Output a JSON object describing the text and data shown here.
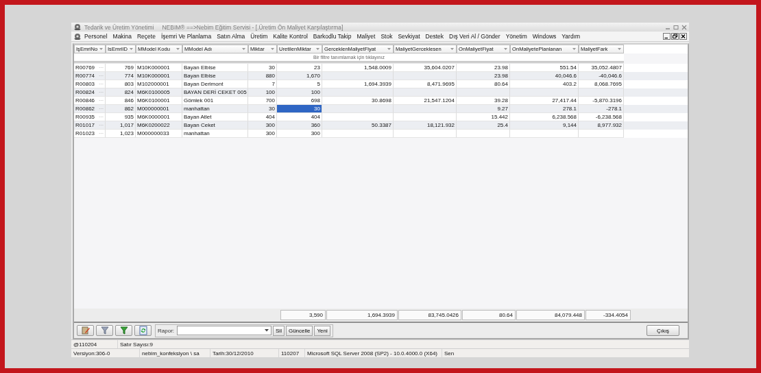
{
  "window": {
    "app_title": "Tedarik ve Üretim Yönetimi",
    "title": "NEBIM® ==>Nebim Eğitim Servisi - [.Üretim Ön Maliyet Karşılaştırma]"
  },
  "menu": [
    "Personel",
    "Makina",
    "Reçete",
    "İşemri Ve Planlama",
    "Satın Alma",
    "Üretim",
    "Kalite Kontrol",
    "Barkodlu Takip",
    "Maliyet",
    "Stok",
    "Sevkiyat",
    "Destek",
    "Dış Veri Al / Gönder",
    "Yönetim",
    "Windows",
    "Yardım"
  ],
  "table": {
    "columns": [
      {
        "label": "IşEmriNo",
        "kind": "text"
      },
      {
        "label": "IsEmriID",
        "kind": "number"
      },
      {
        "label": "MModel Kodu",
        "kind": "text"
      },
      {
        "label": "MModel Adı",
        "kind": "text"
      },
      {
        "label": "Miktar",
        "kind": "number"
      },
      {
        "label": "UretilenMiktar",
        "kind": "number"
      },
      {
        "label": "GerceklenMaliyetFiyat",
        "kind": "number"
      },
      {
        "label": "MaliyetGerceklesen",
        "kind": "number"
      },
      {
        "label": "OnMaliyetFiyat",
        "kind": "number"
      },
      {
        "label": "OnMaliyetePlanlanan",
        "kind": "number"
      },
      {
        "label": "MaliyetFark",
        "kind": "number"
      }
    ],
    "filter_hint": "Bir filtre tanımlamak için tıklayınız",
    "rows": [
      {
        "more_button": "···",
        "cells": [
          {
            "text": "R00769",
            "selected": false
          },
          {
            "text": "769",
            "selected": false
          },
          {
            "text": "M10K000001",
            "selected": false
          },
          {
            "text": "Bayan Elbise",
            "selected": false
          },
          {
            "text": "30",
            "selected": false
          },
          {
            "text": "23",
            "selected": false
          },
          {
            "text": "1,548.0009",
            "selected": false
          },
          {
            "text": "35,604.0207",
            "selected": false
          },
          {
            "text": "23.98",
            "selected": false
          },
          {
            "text": "551.54",
            "selected": false
          },
          {
            "text": "35,052.4807",
            "selected": false
          }
        ]
      },
      {
        "more_button": "···",
        "cells": [
          {
            "text": "R00774",
            "selected": false
          },
          {
            "text": "774",
            "selected": false
          },
          {
            "text": "M10K000001",
            "selected": false
          },
          {
            "text": "Bayan Elbise",
            "selected": false
          },
          {
            "text": "880",
            "selected": false
          },
          {
            "text": "1,670",
            "selected": false
          },
          {
            "selected": false
          },
          {
            "selected": false
          },
          {
            "text": "23.98",
            "selected": false
          },
          {
            "text": "40,046.6",
            "selected": false
          },
          {
            "text": "-40,046.6",
            "selected": false
          }
        ]
      },
      {
        "more_button": "···",
        "cells": [
          {
            "text": "R00803",
            "selected": false
          },
          {
            "text": "803",
            "selected": false
          },
          {
            "text": "M102000001",
            "selected": false
          },
          {
            "text": "Bayan Derimont",
            "selected": false
          },
          {
            "text": "7",
            "selected": false
          },
          {
            "text": "5",
            "selected": false
          },
          {
            "text": "1,694.3939",
            "selected": false
          },
          {
            "text": "8,471.9695",
            "selected": false
          },
          {
            "text": "80.64",
            "selected": false
          },
          {
            "text": "403.2",
            "selected": false
          },
          {
            "text": "8,068.7695",
            "selected": false
          }
        ]
      },
      {
        "more_button": "···",
        "cells": [
          {
            "text": "R00824",
            "selected": false
          },
          {
            "text": "824",
            "selected": false
          },
          {
            "text": "M6K0100005",
            "selected": false
          },
          {
            "text": "BAYAN DERİ CEKET 005",
            "selected": false
          },
          {
            "text": "100",
            "selected": false
          },
          {
            "text": "100",
            "selected": false
          },
          {
            "selected": false
          },
          {
            "selected": false
          },
          {
            "selected": false
          },
          {
            "selected": false
          },
          {
            "selected": false
          }
        ]
      },
      {
        "more_button": "···",
        "cells": [
          {
            "text": "R00846",
            "selected": false
          },
          {
            "text": "846",
            "selected": false
          },
          {
            "text": "M6K0100001",
            "selected": false
          },
          {
            "text": "Gömlek 001",
            "selected": false
          },
          {
            "text": "700",
            "selected": false
          },
          {
            "text": "698",
            "selected": false
          },
          {
            "text": "30.8698",
            "selected": false
          },
          {
            "text": "21,547.1204",
            "selected": false
          },
          {
            "text": "39.28",
            "selected": false
          },
          {
            "text": "27,417.44",
            "selected": false
          },
          {
            "text": "-5,870.3196",
            "selected": false
          }
        ]
      },
      {
        "more_button": "···",
        "cells": [
          {
            "text": "R00862",
            "selected": false
          },
          {
            "text": "862",
            "selected": false
          },
          {
            "text": "M000000001",
            "selected": false
          },
          {
            "text": "manhattan",
            "selected": false
          },
          {
            "text": "30",
            "selected": false
          },
          {
            "text": "30",
            "selected": true
          },
          {
            "selected": false
          },
          {
            "selected": false
          },
          {
            "text": "9.27",
            "selected": false
          },
          {
            "text": "278.1",
            "selected": false
          },
          {
            "text": "-278.1",
            "selected": false
          }
        ]
      },
      {
        "more_button": "···",
        "cells": [
          {
            "text": "R00935",
            "selected": false
          },
          {
            "text": "935",
            "selected": false
          },
          {
            "text": "M6K0000001",
            "selected": false
          },
          {
            "text": "Bayan Atlet",
            "selected": false
          },
          {
            "text": "404",
            "selected": false
          },
          {
            "text": "404",
            "selected": false
          },
          {
            "selected": false
          },
          {
            "selected": false
          },
          {
            "text": "15.442",
            "selected": false
          },
          {
            "text": "6,238.568",
            "selected": false
          },
          {
            "text": "-6,238.568",
            "selected": false
          }
        ]
      },
      {
        "more_button": "···",
        "cells": [
          {
            "text": "R01017",
            "selected": false
          },
          {
            "text": "1,017",
            "selected": false
          },
          {
            "text": "M6K0200022",
            "selected": false
          },
          {
            "text": "Bayan Ceket",
            "selected": false
          },
          {
            "text": "300",
            "selected": false
          },
          {
            "text": "360",
            "selected": false
          },
          {
            "text": "50.3387",
            "selected": false
          },
          {
            "text": "18,121.932",
            "selected": false
          },
          {
            "text": "25.4",
            "selected": false
          },
          {
            "text": "9,144",
            "selected": false
          },
          {
            "text": "8,977.932",
            "selected": false
          }
        ]
      },
      {
        "more_button": "···",
        "cells": [
          {
            "text": "R01023",
            "selected": false
          },
          {
            "text": "1,023",
            "selected": false
          },
          {
            "text": "M000000033",
            "selected": false
          },
          {
            "text": "manhattan",
            "selected": false
          },
          {
            "text": "300",
            "selected": false
          },
          {
            "text": "300",
            "selected": false
          },
          {
            "selected": false
          },
          {
            "selected": false
          },
          {
            "selected": false
          },
          {
            "selected": false
          },
          {
            "selected": false
          }
        ]
      }
    ],
    "totals": [
      {
        "kind": "blank"
      },
      {
        "kind": "blank"
      },
      {
        "kind": "blank"
      },
      {
        "kind": "blank"
      },
      {
        "kind": "blank"
      },
      {
        "kind": "sum",
        "text": "3,590"
      },
      {
        "kind": "sum",
        "text": "1,694.3939"
      },
      {
        "kind": "sum",
        "text": "83,745.0426"
      },
      {
        "kind": "sum",
        "text": "80.64"
      },
      {
        "kind": "sum",
        "text": "84,079.448"
      },
      {
        "kind": "sum",
        "text": "-334.4054"
      }
    ]
  },
  "toolbar": {
    "report_label": "Rapor:",
    "buttons": [
      "Sil",
      "Güncelle",
      "Yeni"
    ],
    "exit_button": "Çıkış"
  },
  "status_bar": {
    "row_1": [
      "@110204",
      "Satır Sayısı:9"
    ],
    "row_2": [
      "Versiyon:306-0",
      "nebim_konfeksiyon \\ sa",
      "Tarih:30/12/2010",
      "110207",
      "Microsoft SQL Server 2008 (SP2) - 10.0.4000.0 (X64)",
      "Sen"
    ]
  }
}
